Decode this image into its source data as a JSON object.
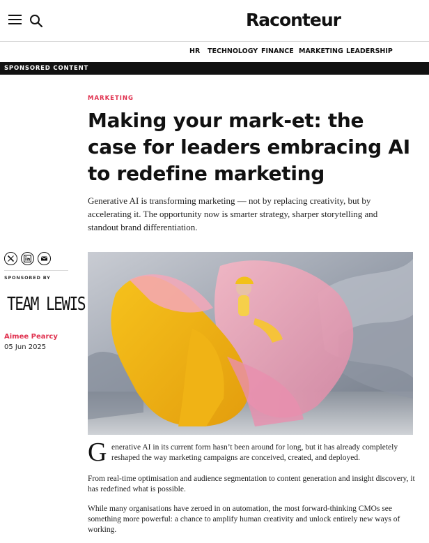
{
  "header": {
    "logo": "Raconteur",
    "menu_icon": "hamburger-menu-icon",
    "search_icon": "search-icon"
  },
  "nav": {
    "items": [
      "HR",
      "TECHNOLOGY",
      "FINANCE",
      "MARKETING",
      "LEADERSHIP"
    ]
  },
  "banner": {
    "label": "SPONSORED CONTENT"
  },
  "article": {
    "kicker": "MARKETING",
    "headline": "Making your mark-et: the case for leaders embracing AI to redefine marketing",
    "standfirst": "Generative AI is transforming marketing — not by replacing creativity, but by accelerating it. The opportunity now is smarter strategy, sharper storytelling and standout brand differentiation.",
    "dropcap": "G",
    "paragraphs": [
      "enerative AI in its current form hasn’t been around for long, but it has already completely reshaped the way marketing campaigns are conceived, created, and deployed.",
      "From real-time optimisation and audience segmentation to content generation and insight discovery, it has redefined what is possible.",
      "While many organisations have zeroed in on automation, the most forward-thinking CMOs see something more powerful: a chance to amplify human creativity and unlock entirely new ways of working."
    ]
  },
  "sidebar": {
    "share_icons": [
      "x-icon",
      "linkedin-icon",
      "email-icon"
    ],
    "sponsored_by_label": "SPONSORED BY",
    "sponsor_name": "TEAM LEWIS",
    "author": "Aimee Pearcy",
    "date": "05 Jun 2025"
  },
  "colors": {
    "accent": "#e0304e",
    "banner_bg": "#111111",
    "text": "#111111"
  }
}
